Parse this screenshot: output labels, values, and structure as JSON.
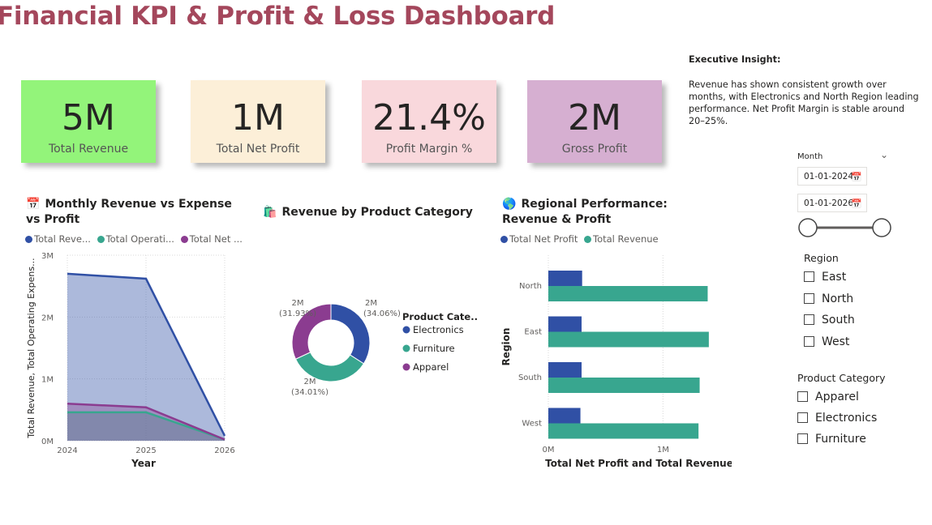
{
  "page": {
    "title": "Financial KPI & Profit & Loss Dashboard"
  },
  "insight": {
    "heading": "Executive Insight:",
    "body": "Revenue has shown consistent growth over months, with Electronics and North Region leading performance. Net Profit Margin is stable around 20–25%."
  },
  "kpis": [
    {
      "value": "5M",
      "label": "Total Revenue",
      "color": "#93f47a"
    },
    {
      "value": "1M",
      "label": "Total Net Profit",
      "color": "#fcefd8"
    },
    {
      "value": "21.4%",
      "label": "Profit Margin %",
      "color": "#f9d8dc"
    },
    {
      "value": "2M",
      "label": "Gross Profit",
      "color": "#d6afd1"
    }
  ],
  "colors": {
    "blue": "#3050a5",
    "teal": "#38a68f",
    "purple": "#8b3c90",
    "title": "#a4475c"
  },
  "area_chart": {
    "title": "Monthly Revenue vs Expense vs Profit",
    "icon": "calendar-icon",
    "icon_glyph": "📅",
    "legend": [
      "Total Reve...",
      "Total Operati...",
      "Total Net ..."
    ],
    "ylabel": "Total Revenue, Total Operating Expens...",
    "xlabel": "Year",
    "y_ticks": [
      "0M",
      "1M",
      "2M",
      "3M"
    ],
    "x_ticks": [
      "2024",
      "2025",
      "2026"
    ]
  },
  "donut_chart": {
    "title": "Revenue by Product Category",
    "icon": "shopping-bag-icon",
    "icon_glyph": "🛍️",
    "legend_title": "Product Cate...",
    "labels": [
      {
        "value": "2M",
        "pct": "(34.06%)"
      },
      {
        "value": "2M",
        "pct": "(34.01%)"
      },
      {
        "value": "2M",
        "pct": "(31.93%)"
      }
    ]
  },
  "bar_chart": {
    "title": "Regional Performance: Revenue & Profit",
    "icon": "globe-icon",
    "icon_glyph": "🌎",
    "legend": [
      "Total Net Profit",
      "Total Revenue"
    ],
    "ylabel": "Region",
    "xlabel": "Total Net Profit and Total Revenue",
    "x_ticks": [
      "0M",
      "1M"
    ]
  },
  "slicers": {
    "month_label": "Month",
    "date_start": "01-01-2024",
    "date_end": "01-01-2026",
    "region_label": "Region",
    "regions": [
      "East",
      "North",
      "South",
      "West"
    ],
    "category_label": "Product Category",
    "categories": [
      "Apparel",
      "Electronics",
      "Furniture"
    ]
  },
  "chart_data": [
    {
      "type": "area",
      "title": "Monthly Revenue vs Expense vs Profit",
      "x": [
        2024,
        2025,
        2026
      ],
      "xlabel": "Year",
      "ylabel": "Total Revenue, Total Operating Expens...",
      "ylim": [
        0,
        3000000
      ],
      "grid": true,
      "legend_position": "top",
      "series": [
        {
          "name": "Total Reve...",
          "values": [
            2700000,
            2620000,
            80000
          ]
        },
        {
          "name": "Total Operati...",
          "values": [
            460000,
            460000,
            20000
          ]
        },
        {
          "name": "Total Net ...",
          "values": [
            600000,
            540000,
            20000
          ]
        }
      ]
    },
    {
      "type": "pie",
      "title": "Revenue by Product Category",
      "categories": [
        "Electronics",
        "Furniture",
        "Apparel"
      ],
      "values": [
        34.06,
        34.01,
        31.93
      ],
      "legend_position": "right"
    },
    {
      "type": "bar",
      "title": "Regional Performance: Revenue & Profit",
      "categories": [
        "North",
        "East",
        "South",
        "West"
      ],
      "xlabel": "Total Net Profit and Total Revenue",
      "ylabel": "Region",
      "xlim": [
        0,
        1500000
      ],
      "grid": true,
      "legend_position": "top",
      "series": [
        {
          "name": "Total Net Profit",
          "values": [
            295000,
            290000,
            290000,
            280000
          ]
        },
        {
          "name": "Total Revenue",
          "values": [
            1390000,
            1400000,
            1320000,
            1310000
          ]
        }
      ]
    }
  ]
}
